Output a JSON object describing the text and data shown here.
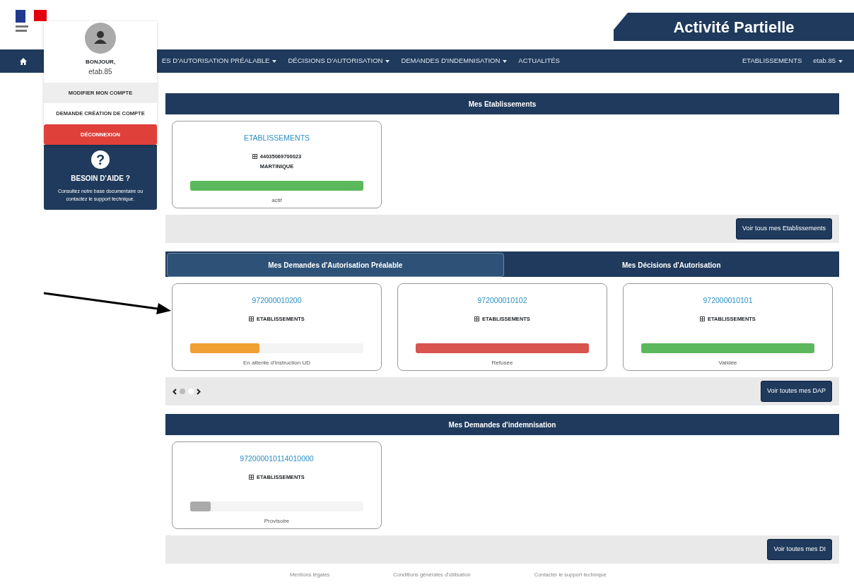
{
  "header": {
    "title": "Activité Partielle"
  },
  "nav": {
    "left": [
      {
        "label": "ES D'AUTORISATION PRÉALABLE",
        "caret": true
      },
      {
        "label": "DÉCISIONS D'AUTORISATION",
        "caret": true
      },
      {
        "label": "DEMANDES D'INDEMNISATION",
        "caret": true
      },
      {
        "label": "ACTUALITÉS",
        "caret": false
      }
    ],
    "right": [
      {
        "label": "ETABLISSEMENTS",
        "caret": false
      },
      {
        "label": "etab.85",
        "caret": true
      }
    ]
  },
  "user_menu": {
    "greeting": "BONJOUR,",
    "user": "etab.85",
    "items": [
      {
        "label": "MODIFIER MON COMPTE",
        "kind": "light"
      },
      {
        "label": "DEMANDE CRÉATION DE COMPTE",
        "kind": "plain"
      },
      {
        "label": "DÉCONNEXION",
        "kind": "danger"
      }
    ]
  },
  "help": {
    "icon": "?",
    "title": "BESOIN D'AIDE ?",
    "text": "Consultez notre base documentaire ou contactez le support technique."
  },
  "establishments": {
    "title": "Mes Etablissements",
    "cards": [
      {
        "title": "ETABLISSEMENTS",
        "lines": [
          "44035069700023",
          "MARTINIQUE"
        ],
        "level": 1,
        "color": "#5cb85c",
        "status": "actif"
      }
    ],
    "button": "Voir tous mes Etablissements"
  },
  "requests": {
    "tabs": [
      {
        "label": "Mes Demandes d'Autorisation Préalable",
        "selected": true
      },
      {
        "label": "Mes Décisions d'Autorisation",
        "selected": false
      }
    ],
    "cards": [
      {
        "title": "972000010200",
        "lines": [
          "ETABLISSEMENTS"
        ],
        "level": 0.4,
        "color": "#f0a030",
        "status": "En attente d'instruction UD"
      },
      {
        "title": "972000010102",
        "lines": [
          "ETABLISSEMENTS"
        ],
        "level": 1,
        "color": "#d9534f",
        "status": "Refusée"
      },
      {
        "title": "972000010101",
        "lines": [
          "ETABLISSEMENTS"
        ],
        "level": 1,
        "color": "#5cb85c",
        "status": "Validée"
      }
    ],
    "pager": [
      {
        "selected": true
      },
      {
        "selected": false
      }
    ],
    "button": "Voir toutes mes DAP"
  },
  "compensation": {
    "title": "Mes Demandes d'indemnisation",
    "cards": [
      {
        "title": "972000010114010000",
        "lines": [
          "ETABLISSEMENTS"
        ],
        "level": 0.12,
        "color": "#aaaaaa",
        "status": "Provisoire"
      }
    ],
    "button": "Voir toutes mes DI"
  },
  "footer": [
    "Mentions légales",
    "Conditions générales d'utilisation",
    "Contacter le support technique"
  ]
}
